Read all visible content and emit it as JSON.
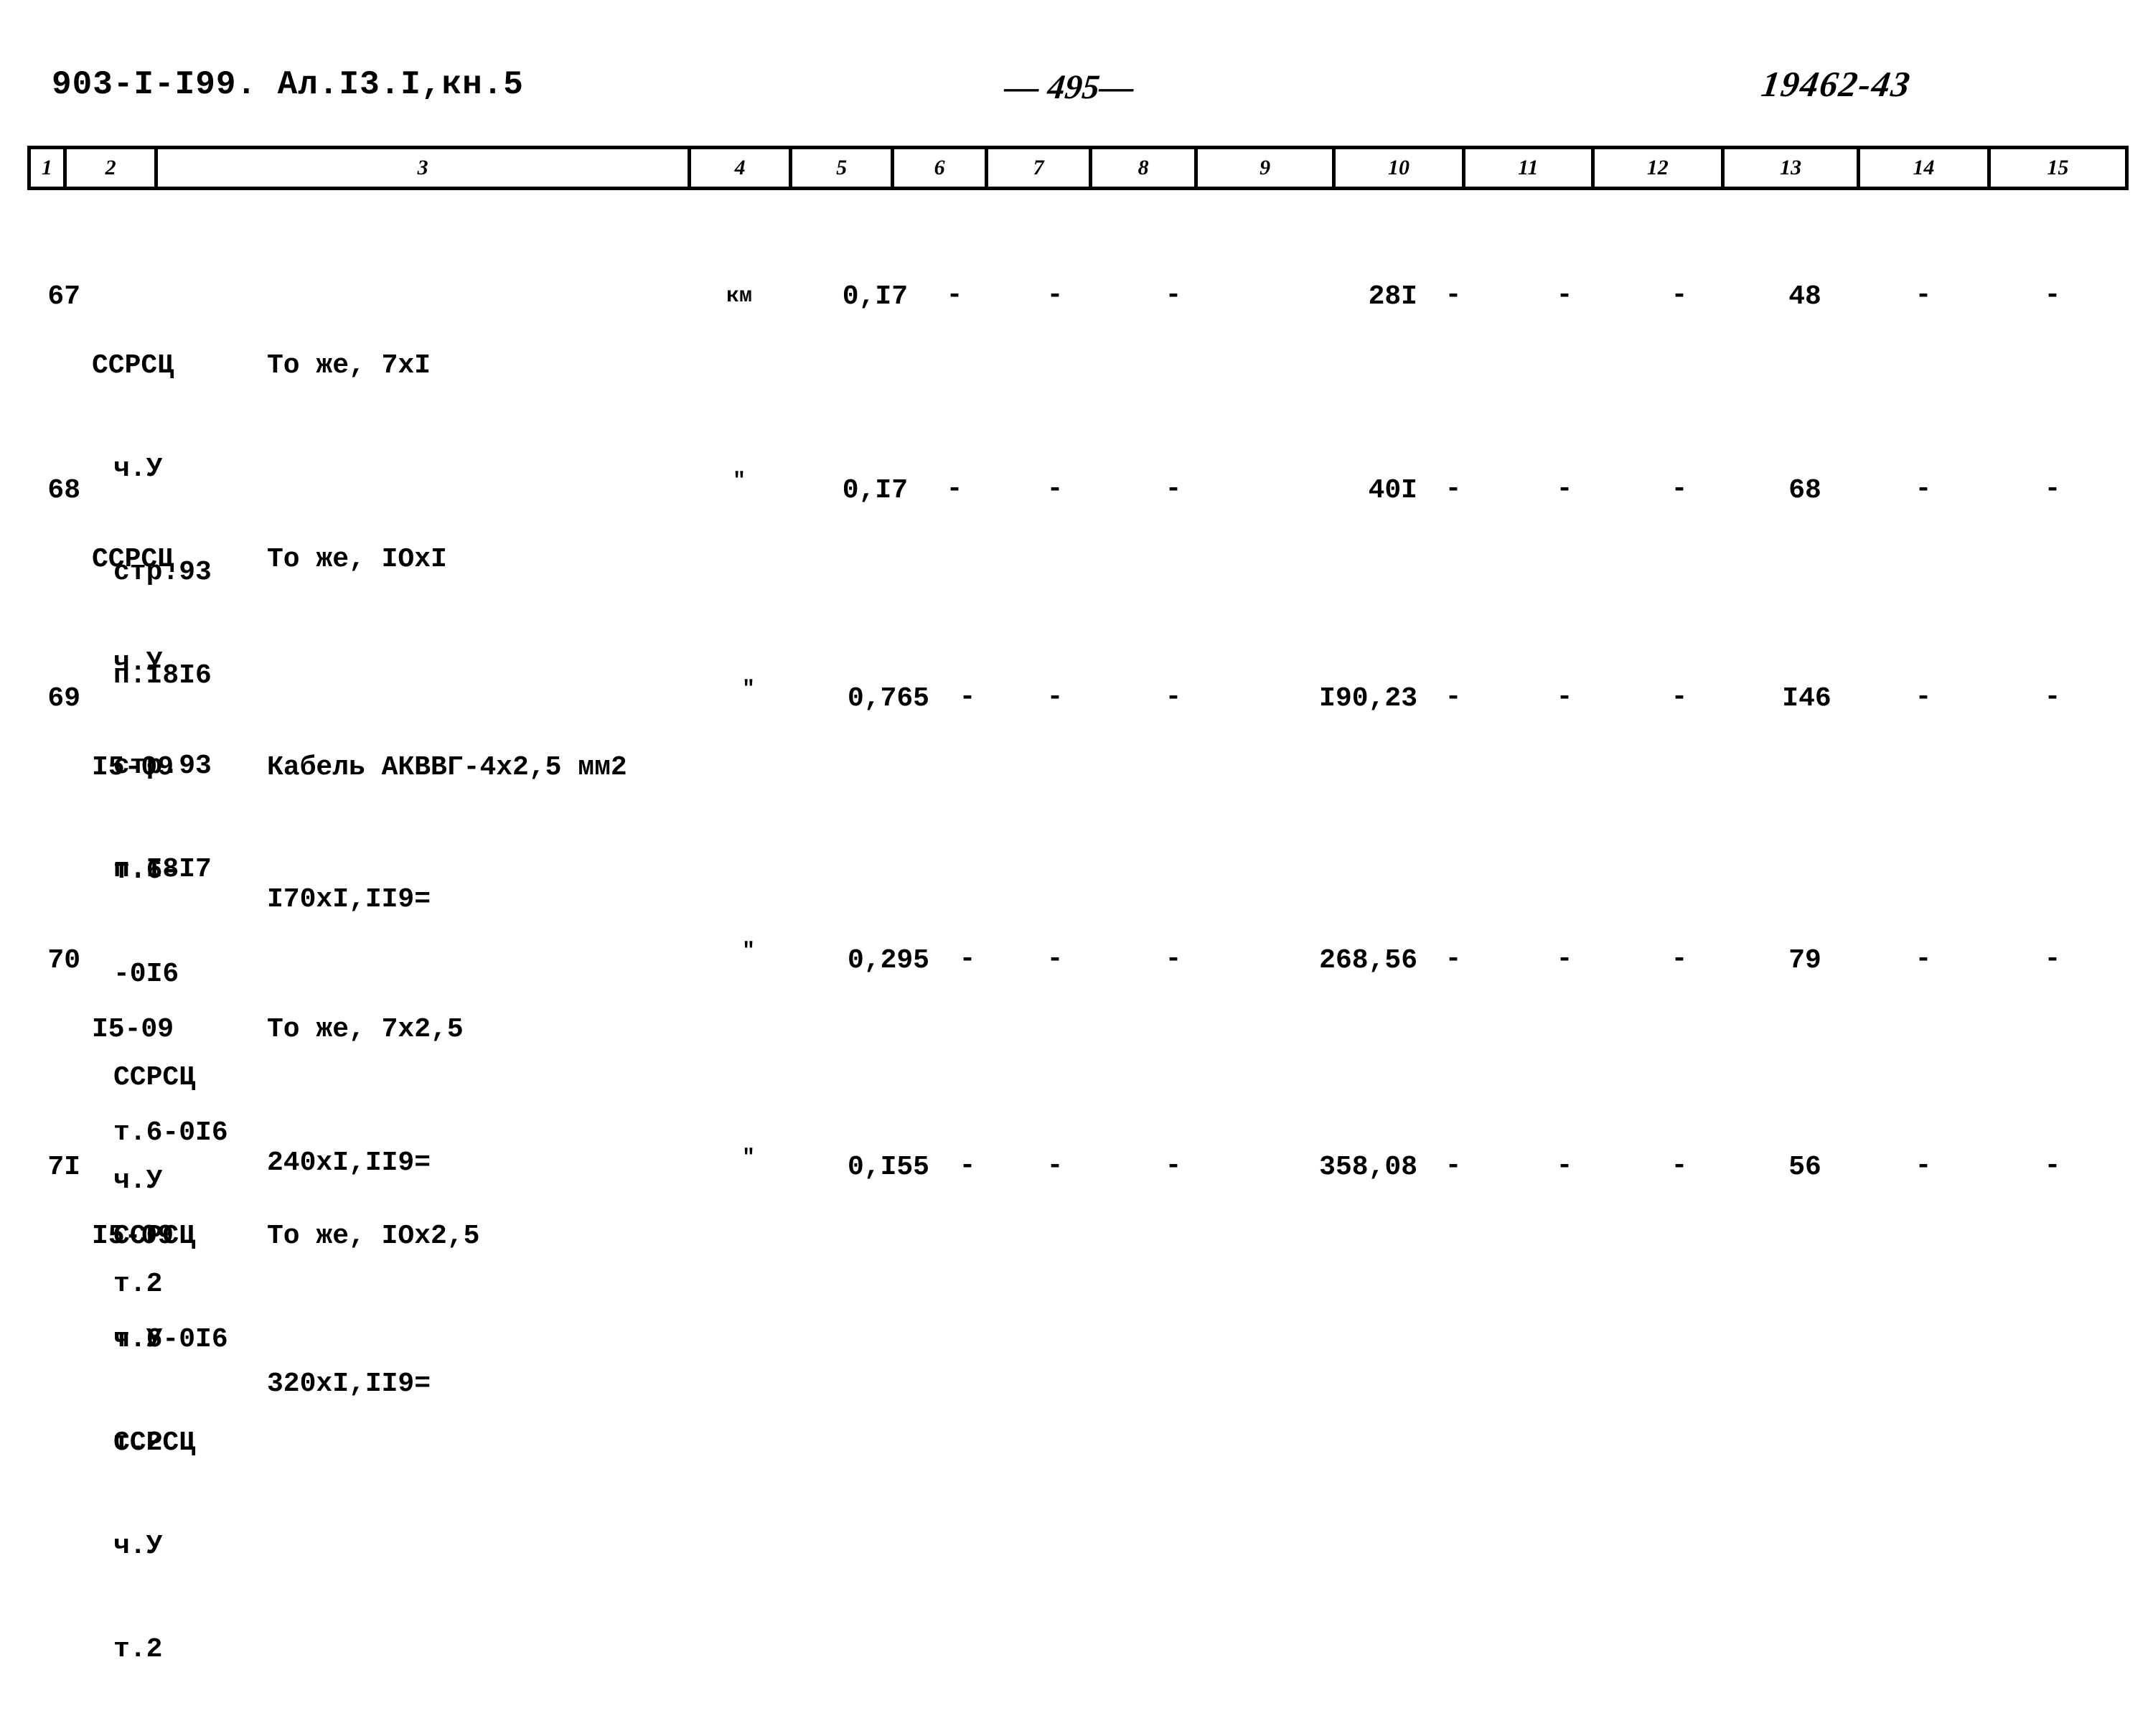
{
  "header": {
    "doc_code": "903-I-I99. Ал.I3.I,кн.5",
    "page_number": "— 495—",
    "archive_number": "19462-43"
  },
  "table": {
    "column_numbers": [
      "1",
      "2",
      "3",
      "4",
      "5",
      "6",
      "7",
      "8",
      "9",
      "10",
      "11",
      "12",
      "13",
      "14",
      "15"
    ],
    "rows": [
      {
        "no": "67",
        "ref_lines": [
          "ССРСЦ",
          "ч.У",
          "стр.93",
          "п.I8I6"
        ],
        "desc_lines": [
          "То же, 7хI"
        ],
        "unit": "км",
        "c5": "0,I7",
        "c6": "-",
        "c7": "-",
        "c8": "-",
        "c9": "28I",
        "c10": "-",
        "c11": "-",
        "c12": "-",
        "c13": "48",
        "c14": "-",
        "c15": "-"
      },
      {
        "no": "68",
        "ref_lines": [
          "ССРСЦ",
          "ч.У",
          "стр.93",
          "п.I8I7"
        ],
        "desc_lines": [
          "То же, IOхI"
        ],
        "unit": "\"",
        "c5": "0,I7",
        "c6": "-",
        "c7": "-",
        "c8": "-",
        "c9": "40I",
        "c10": "-",
        "c11": "-",
        "c12": "-",
        "c13": "68",
        "c14": "-",
        "c15": "-"
      },
      {
        "no": "69",
        "ref_lines": [
          "I5-09",
          "т.6-",
          "-0I6",
          "ССРСЦ",
          "ч.У",
          "т.2"
        ],
        "desc_lines": [
          "Кабель АКВВГ-4х2,5 мм2",
          "I70хI,II9="
        ],
        "unit": "\"",
        "c5": "0,765",
        "c6": "-",
        "c7": "-",
        "c8": "-",
        "c9": "I90,23",
        "c10": "-",
        "c11": "-",
        "c12": "-",
        "c13": "I46",
        "c14": "-",
        "c15": "-"
      },
      {
        "no": "70",
        "ref_lines": [
          "I5-09",
          "т.6-0I6",
          "ССРСЦ",
          "ч.У",
          "т.2"
        ],
        "desc_lines": [
          "То же, 7х2,5",
          "240хI,II9="
        ],
        "unit": "\"",
        "c5": "0,295",
        "c6": "-",
        "c7": "-",
        "c8": "-",
        "c9": "268,56",
        "c10": "-",
        "c11": "-",
        "c12": "-",
        "c13": "79",
        "c14": "-",
        "c15": "-"
      },
      {
        "no": "7I",
        "ref_lines": [
          "I5-09",
          "т.6-0I6",
          "ССРСЦ",
          "ч.У",
          "т.2"
        ],
        "desc_lines": [
          "То же, IOх2,5",
          "320хI,II9="
        ],
        "unit": "\"",
        "c5": "0,I55",
        "c6": "-",
        "c7": "-",
        "c8": "-",
        "c9": "358,08",
        "c10": "-",
        "c11": "-",
        "c12": "-",
        "c13": "56",
        "c14": "-",
        "c15": "-"
      }
    ]
  }
}
